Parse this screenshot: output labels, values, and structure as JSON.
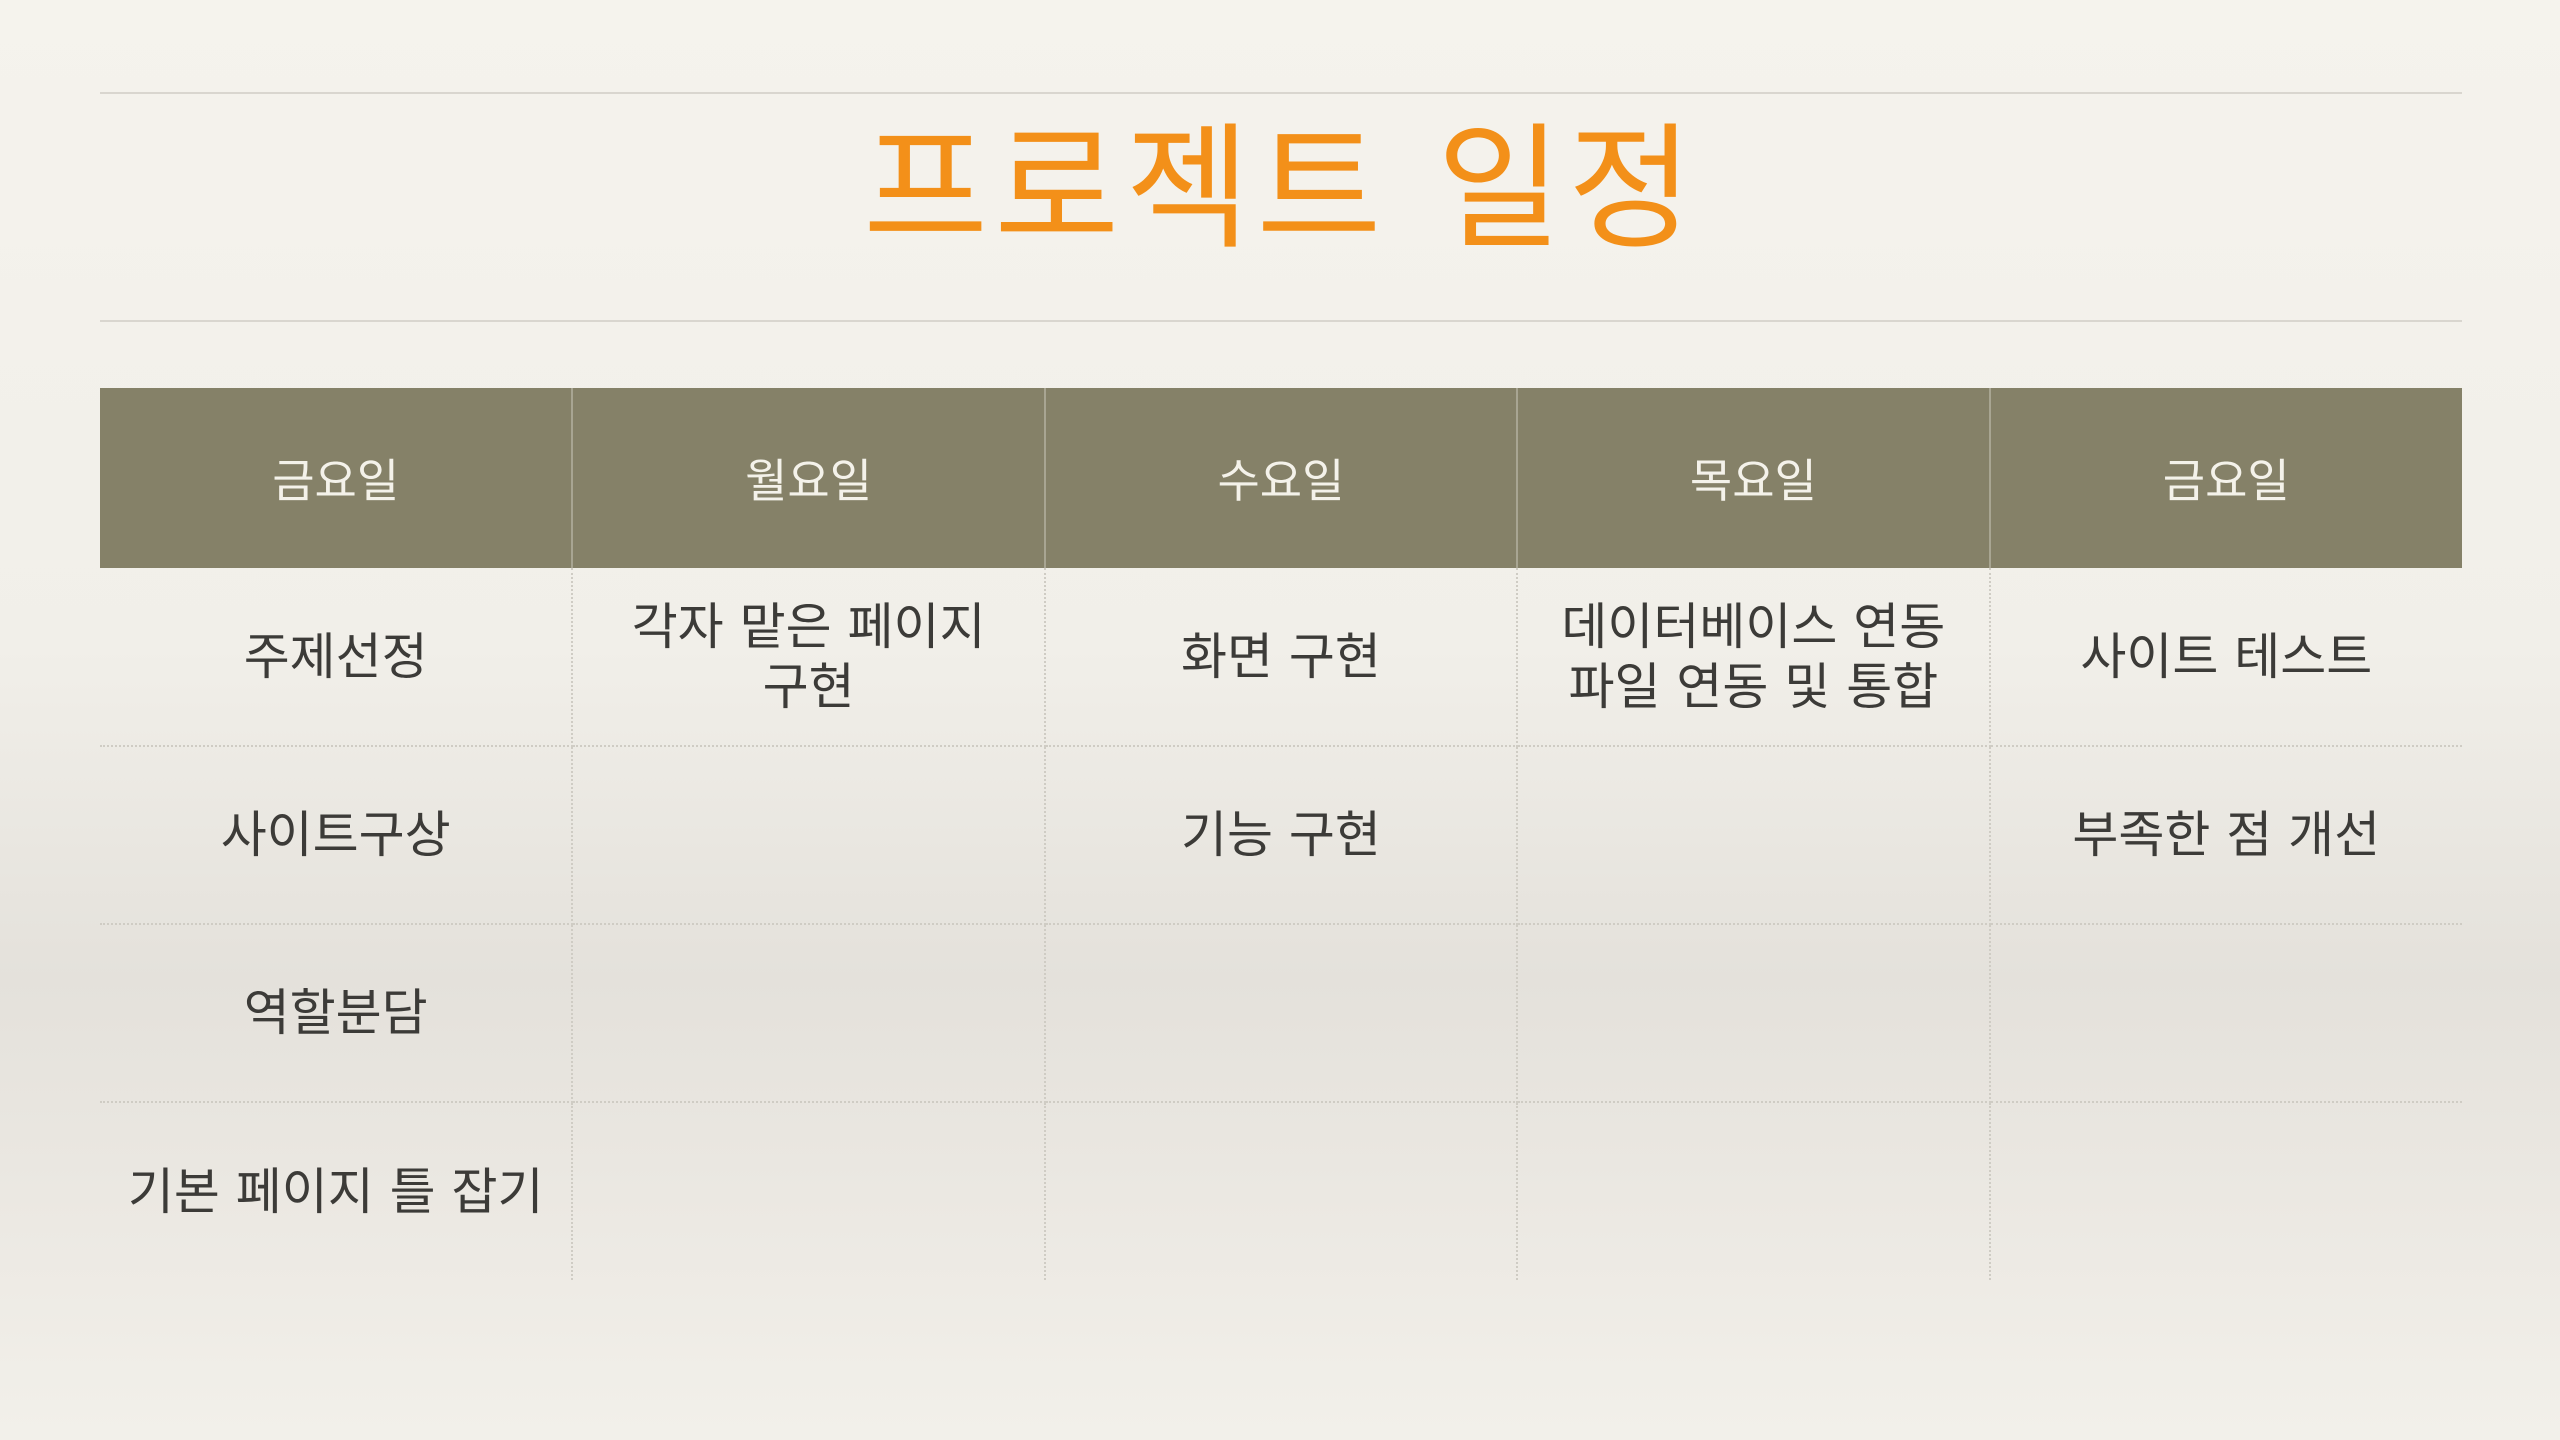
{
  "slide": {
    "title": "프로젝트 일정",
    "title_color": "#f39019",
    "header_bg_color": "#858168"
  },
  "table": {
    "headers": [
      "금요일",
      "월요일",
      "수요일",
      "목요일",
      "금요일"
    ],
    "rows": [
      [
        [
          "주제선정"
        ],
        [
          "각자 맡은 페이지",
          "구현"
        ],
        [
          "화면 구현"
        ],
        [
          "데이터베이스 연동",
          "파일 연동 및 통합"
        ],
        [
          "사이트 테스트"
        ]
      ],
      [
        [
          "사이트구상"
        ],
        [],
        [
          "기능 구현"
        ],
        [],
        [
          "부족한 점 개선"
        ]
      ],
      [
        [
          "역할분담"
        ],
        [],
        [],
        [],
        []
      ],
      [
        [
          "기본 페이지 틀 잡기"
        ],
        [],
        [],
        [],
        []
      ]
    ]
  }
}
